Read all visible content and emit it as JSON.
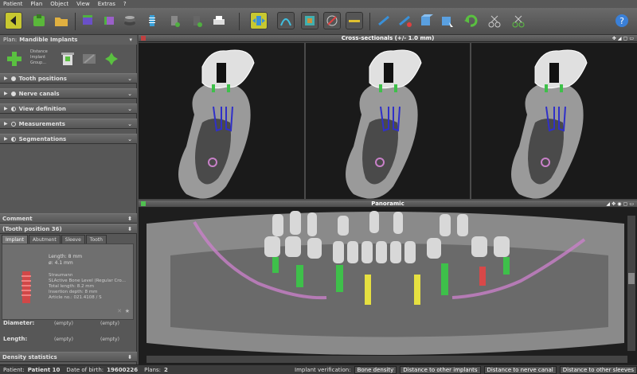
{
  "menu": [
    "Patient",
    "Plan",
    "Object",
    "View",
    "Extras",
    "?"
  ],
  "plan": {
    "label": "Plan:",
    "name": "Mandible Implants"
  },
  "plan_actions": [
    "Distance",
    "Implant",
    "Group..."
  ],
  "sections": [
    {
      "label": "Tooth positions",
      "icon": "rad-on"
    },
    {
      "label": "Nerve canals",
      "icon": "rad-on"
    },
    {
      "label": "View definition",
      "icon": "half"
    },
    {
      "label": "Measurements",
      "icon": "rad"
    },
    {
      "label": "Segmentations",
      "icon": "half"
    }
  ],
  "comment": {
    "label": "Comment"
  },
  "tooth_position": {
    "label": "(Tooth position 36)"
  },
  "tabs": [
    "Implant",
    "Abutment",
    "Sleeve",
    "Tooth"
  ],
  "implant": {
    "length": "Length: 8 mm",
    "diameter": "ø: 4.1 mm",
    "brand": "Straumann",
    "model": "SLActive Bone Level (Regular Cro...",
    "total_length": "Total length: 8.2 mm",
    "insertion": "Insertion depth: 8 mm",
    "article": "Article no.: 021.4108 / S"
  },
  "diameter_field": {
    "label": "Diameter:",
    "v1": "(empty)",
    "v2": "(empty)"
  },
  "length_field": {
    "label": "Length:",
    "v1": "(empty)",
    "v2": "(empty)"
  },
  "density": {
    "label": "Density statistics"
  },
  "views": {
    "cross": "Cross-sectionals (+/- 1.0 mm)",
    "pano": "Panoramic"
  },
  "statusbar": {
    "patient_label": "Patient:",
    "patient": "Patient 10",
    "dob_label": "Date of birth:",
    "dob": "19600226",
    "plans_label": "Plans:",
    "plans": "2",
    "verif_label": "Implant verification:",
    "buttons": [
      "Bone density",
      "Distance to other implants",
      "Distance to nerve canal",
      "Distance to other sleeves"
    ]
  },
  "colors": {
    "implant_green": "#3ec04a",
    "implant_yellow": "#e6e040",
    "implant_red": "#d84848",
    "nerve": "#c880c8",
    "blue": "#3030c8"
  }
}
